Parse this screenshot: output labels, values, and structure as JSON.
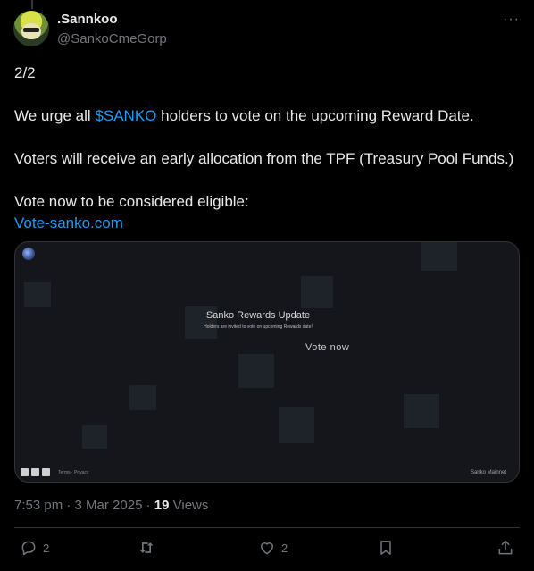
{
  "author": {
    "display_name": ".Sannkoo",
    "handle": "@SankoCmeGorp"
  },
  "tweet": {
    "part_label": "2/2",
    "line1_prefix": "We urge all ",
    "line1_cashtag": "$SANKO",
    "line1_suffix": " holders to vote on the upcoming Reward Date.",
    "line2": "Voters will receive an early allocation from the TPF (Treasury Pool Funds.)",
    "line3": "Vote now to be considered eligible:",
    "link": "Vote-sanko.com"
  },
  "card": {
    "title": "Sanko Rewards Update",
    "subtitle": "Holders are invited to vote on upcoming Rewards date!",
    "cta": "Vote now",
    "footer_links": "Terms  ·  Privacy",
    "brand": "Sanko Mainnet"
  },
  "meta": {
    "time": "7:53 pm",
    "date": "3 Mar 2025",
    "views_count": "19",
    "views_label": "Views"
  },
  "actions": {
    "reply_count": "2",
    "like_count": "2"
  },
  "icons": [
    "more-icon",
    "reply-icon",
    "retweet-icon",
    "like-icon",
    "bookmark-icon",
    "share-icon"
  ],
  "colors": {
    "link": "#1d9bf0",
    "muted": "#71767b",
    "text": "#e7e9ea",
    "background": "#000000"
  }
}
